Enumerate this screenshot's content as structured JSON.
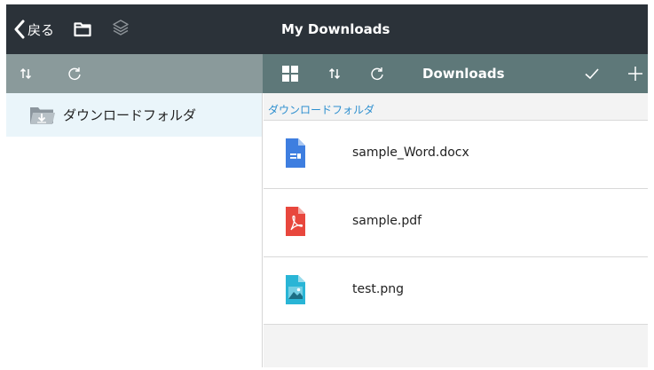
{
  "topbar": {
    "back_label": "戻る",
    "title": "My Downloads",
    "folder_icon": "folder-icon",
    "layers_icon": "layers-icon"
  },
  "sidebar_toolbar": {
    "sort_icon": "sort-icon",
    "refresh_icon": "refresh-icon"
  },
  "main_toolbar": {
    "title": "Downloads",
    "grid_icon": "grid-view-icon",
    "sort_icon": "sort-icon",
    "refresh_icon": "refresh-icon",
    "select_icon": "checkmark-icon",
    "add_icon": "plus-icon"
  },
  "sidebar": {
    "items": [
      {
        "label": "ダウンロードフォルダ",
        "icon": "download-folder-icon"
      }
    ]
  },
  "main": {
    "breadcrumb": "ダウンロードフォルダ",
    "files": [
      {
        "name": "sample_Word.docx",
        "icon": "word-document-icon",
        "color": "#3e7ee0"
      },
      {
        "name": "sample.pdf",
        "icon": "pdf-document-icon",
        "color": "#e8473d"
      },
      {
        "name": "test.png",
        "icon": "image-file-icon",
        "color": "#29b5d6"
      }
    ]
  },
  "colors": {
    "topbar": "#2b3239",
    "sidebar_toolbar": "#8a9a9b",
    "main_toolbar": "#5e7879",
    "selected_item": "#eaf5fa",
    "link": "#2d8fcf"
  }
}
